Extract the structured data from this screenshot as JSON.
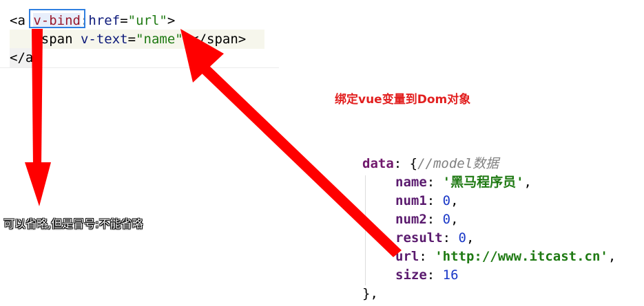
{
  "code_top": {
    "line1": {
      "open": "<a ",
      "directive": "v-bind",
      "colon": ":",
      "attr": "href",
      "eq": "=",
      "value": "\"url\"",
      "close": ">"
    },
    "line2": {
      "indent": "   ",
      "open": "<span ",
      "attr": "v-text",
      "eq": "=",
      "value": "\"name\"",
      "close": "></span>"
    },
    "line3": {
      "text": "</a>"
    }
  },
  "annotations": {
    "bind_to_dom": "绑定vue变量到Dom对象",
    "can_omit": "可以省略,但是冒号:不能省略"
  },
  "code_bottom": {
    "data_key": "data",
    "open": ": {",
    "comment": "//model数据",
    "fields": [
      {
        "key": "name",
        "value": "'黑马程序员'",
        "type": "string"
      },
      {
        "key": "num1",
        "value": "0",
        "type": "number"
      },
      {
        "key": "num2",
        "value": "0",
        "type": "number"
      },
      {
        "key": "result",
        "value": "0",
        "type": "number"
      },
      {
        "key": "url",
        "value": "'http://www.itcast.cn'",
        "type": "string"
      },
      {
        "key": "size",
        "value": "16",
        "type": "number"
      }
    ],
    "close": "},"
  },
  "colors": {
    "arrow": "#ff0000",
    "highlight_box": "#2f7fe0",
    "annotation_text": "#e21f1f"
  }
}
